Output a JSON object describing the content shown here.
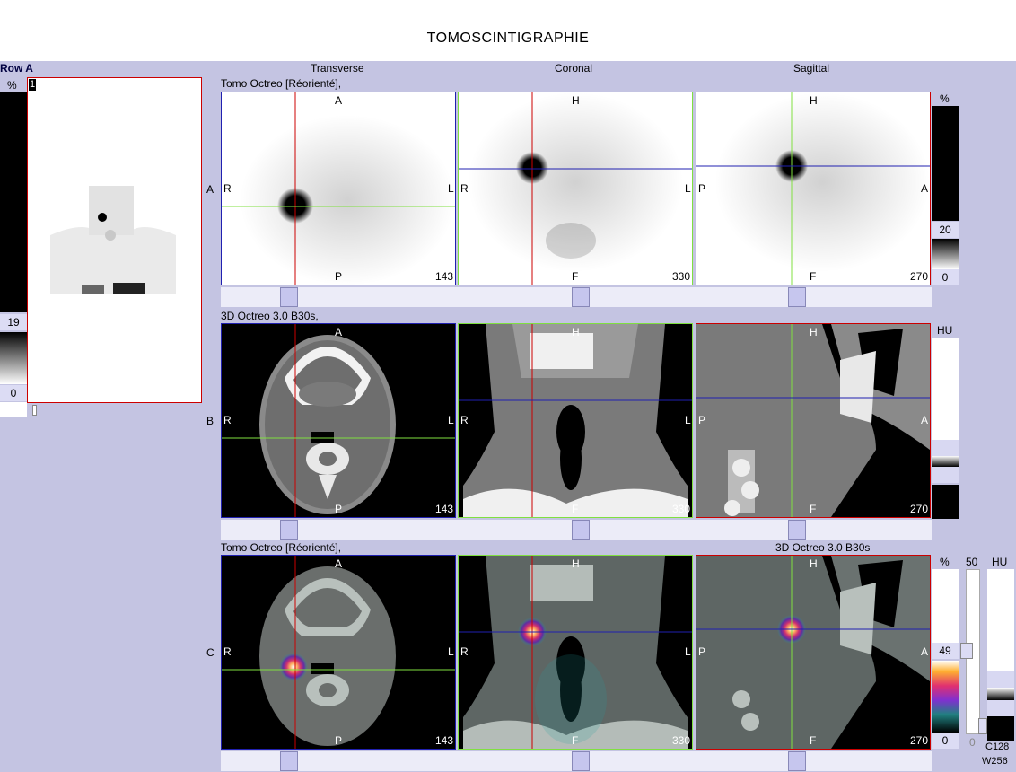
{
  "header": {
    "title": "TOMOSCINTIGRAPHIE"
  },
  "left_panel": {
    "row_label": "Row A",
    "pct_label": "%",
    "image_index": "1",
    "scale_top": "19",
    "scale_bottom": "0"
  },
  "columns": {
    "transverse": "Transverse",
    "coronal": "Coronal",
    "sagittal": "Sagittal"
  },
  "rows": {
    "a": {
      "letter": "A",
      "series_label": "Tomo Octreo [Réorienté],"
    },
    "b": {
      "letter": "B",
      "series_label": "3D Octreo  3.0  B30s,"
    },
    "c": {
      "letter": "C",
      "series_label_left": "Tomo Octreo [Réorienté],",
      "series_label_right": "3D Octreo  3.0  B30s"
    }
  },
  "orientation": {
    "transverse": {
      "top": "A",
      "left": "R",
      "right": "L",
      "bottom": "P",
      "slice": "143"
    },
    "coronal": {
      "top": "H",
      "left": "R",
      "right": "L",
      "bottom": "F",
      "slice": "330"
    },
    "sagittal": {
      "top": "H",
      "left": "P",
      "right": "A",
      "bottom": "F",
      "slice": "270"
    }
  },
  "scales": {
    "row_a": {
      "unit": "%",
      "top": "20",
      "bottom": "0"
    },
    "row_b": {
      "unit": "HU"
    },
    "row_c": {
      "unit_pct": "%",
      "value_50": "50",
      "unit_hu": "HU",
      "top": "49",
      "bottom": "0",
      "bottom2": "0",
      "c": "C128",
      "w": "W256"
    }
  },
  "colors": {
    "background": "#c4c4e2",
    "red": "#cc0000",
    "green": "#80e040",
    "blue": "#2020b0"
  }
}
